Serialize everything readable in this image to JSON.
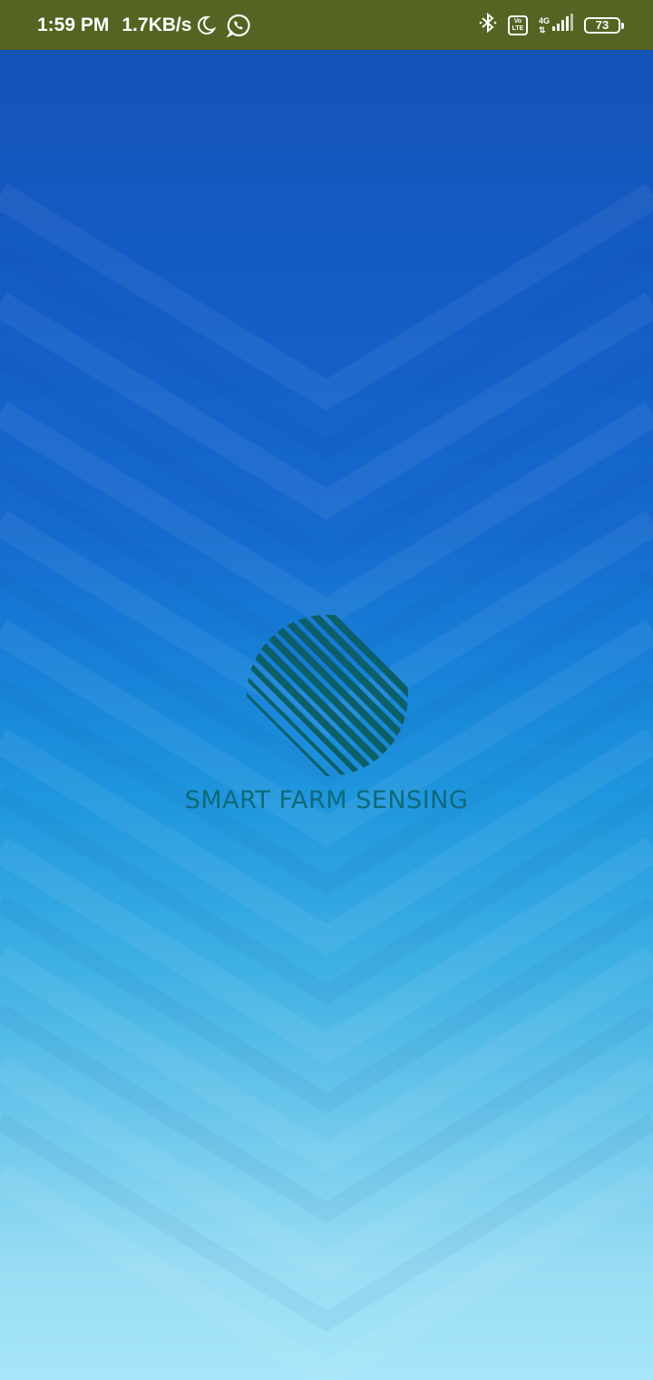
{
  "status_bar": {
    "time": "1:59 PM",
    "net_speed": "1.7KB/s",
    "volte_top": "Vo",
    "volte_bottom": "LTE",
    "network_type": "4G",
    "battery_level": "73",
    "background_color": "#546422",
    "icons": [
      "moon-icon",
      "whatsapp-icon",
      "bluetooth-icon",
      "volte-icon",
      "signal-icon",
      "battery-icon"
    ]
  },
  "splash": {
    "brand_name": "SMART FARM SENSING",
    "brand_color": "#0d6a79",
    "logo_color": "#0c5f68",
    "gradient_top": "#1552b4",
    "gradient_bottom": "#a6e6fa"
  }
}
